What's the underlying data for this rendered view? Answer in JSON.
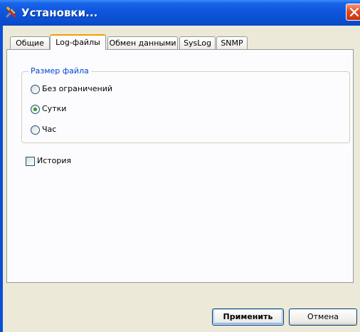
{
  "window": {
    "title": "Установки...",
    "icon": "tools-icon",
    "close_icon": "close-icon"
  },
  "tabs": [
    {
      "label": "Общие",
      "active": false
    },
    {
      "label": "Log-файлы",
      "active": true
    },
    {
      "label": "Обмен данными",
      "active": false
    },
    {
      "label": "SysLog",
      "active": false
    },
    {
      "label": "SNMP",
      "active": false
    }
  ],
  "file_size": {
    "legend": "Размер файла",
    "options": [
      {
        "label": "Без ограничений",
        "selected": false
      },
      {
        "label": "Сутки",
        "selected": true
      },
      {
        "label": "Час",
        "selected": false
      }
    ]
  },
  "history": {
    "label": "История",
    "checked": false
  },
  "buttons": {
    "apply": "Применить",
    "cancel": "Отмена"
  },
  "colors": {
    "titlebar": "#0b4fd6",
    "client": "#ece9d8",
    "legend_text": "#0046d5",
    "radio_selected": "#21a121"
  }
}
